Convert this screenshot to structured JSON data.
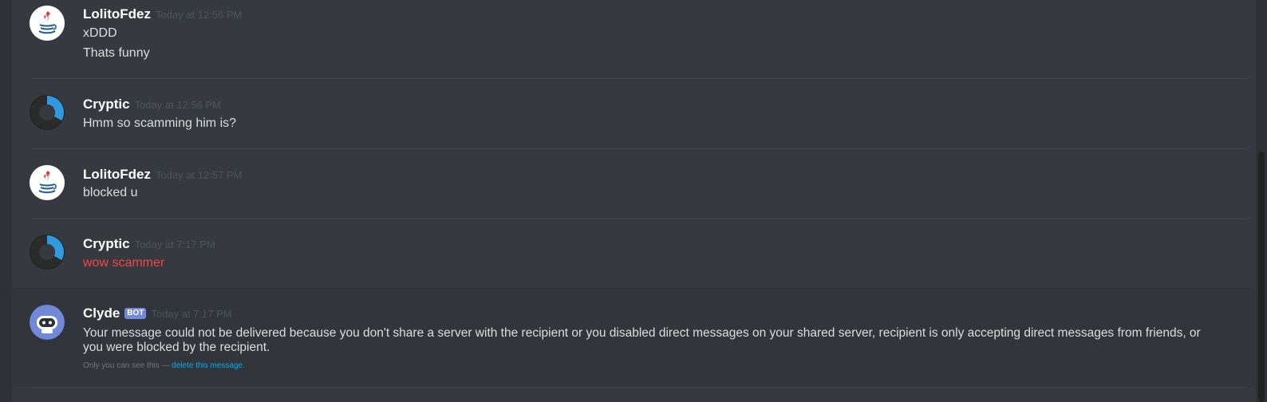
{
  "colors": {
    "background": "#36393f",
    "username": "#ffffff",
    "message_text": "#dcddde",
    "timestamp": "#4f545c",
    "failed_message": "#f04747",
    "bot_tag": "#7289da",
    "link": "#00b0f4"
  },
  "messages": [
    {
      "author": "LolitoFdez",
      "avatar_icon": "java-logo-icon",
      "timestamp": "Today at 12:56 PM",
      "lines": [
        "xDDD",
        "Thats funny"
      ]
    },
    {
      "author": "Cryptic",
      "avatar_icon": "ring-avatar-icon",
      "timestamp": "Today at 12:56 PM",
      "lines": [
        "Hmm so scamming him is?"
      ]
    },
    {
      "author": "LolitoFdez",
      "avatar_icon": "java-logo-icon",
      "timestamp": "Today at 12:57 PM",
      "lines": [
        "blocked u"
      ]
    },
    {
      "author": "Cryptic",
      "avatar_icon": "ring-avatar-icon",
      "timestamp": "Today at 7:17 PM",
      "lines": [
        "wow scammer"
      ],
      "failed": true
    },
    {
      "author": "Clyde",
      "avatar_icon": "robot-avatar-icon",
      "tag": "BOT",
      "timestamp": "Today at 7:17 PM",
      "lines": [
        "Your message could not be delivered because you don't share a server with the recipient or you disabled direct messages on your shared server, recipient is only accepting direct messages from friends, or you were blocked by the recipient."
      ],
      "ephemeral_notice": "Only you can see this — ",
      "ephemeral_link": "delete this message",
      "ephemeral_suffix": "."
    }
  ]
}
